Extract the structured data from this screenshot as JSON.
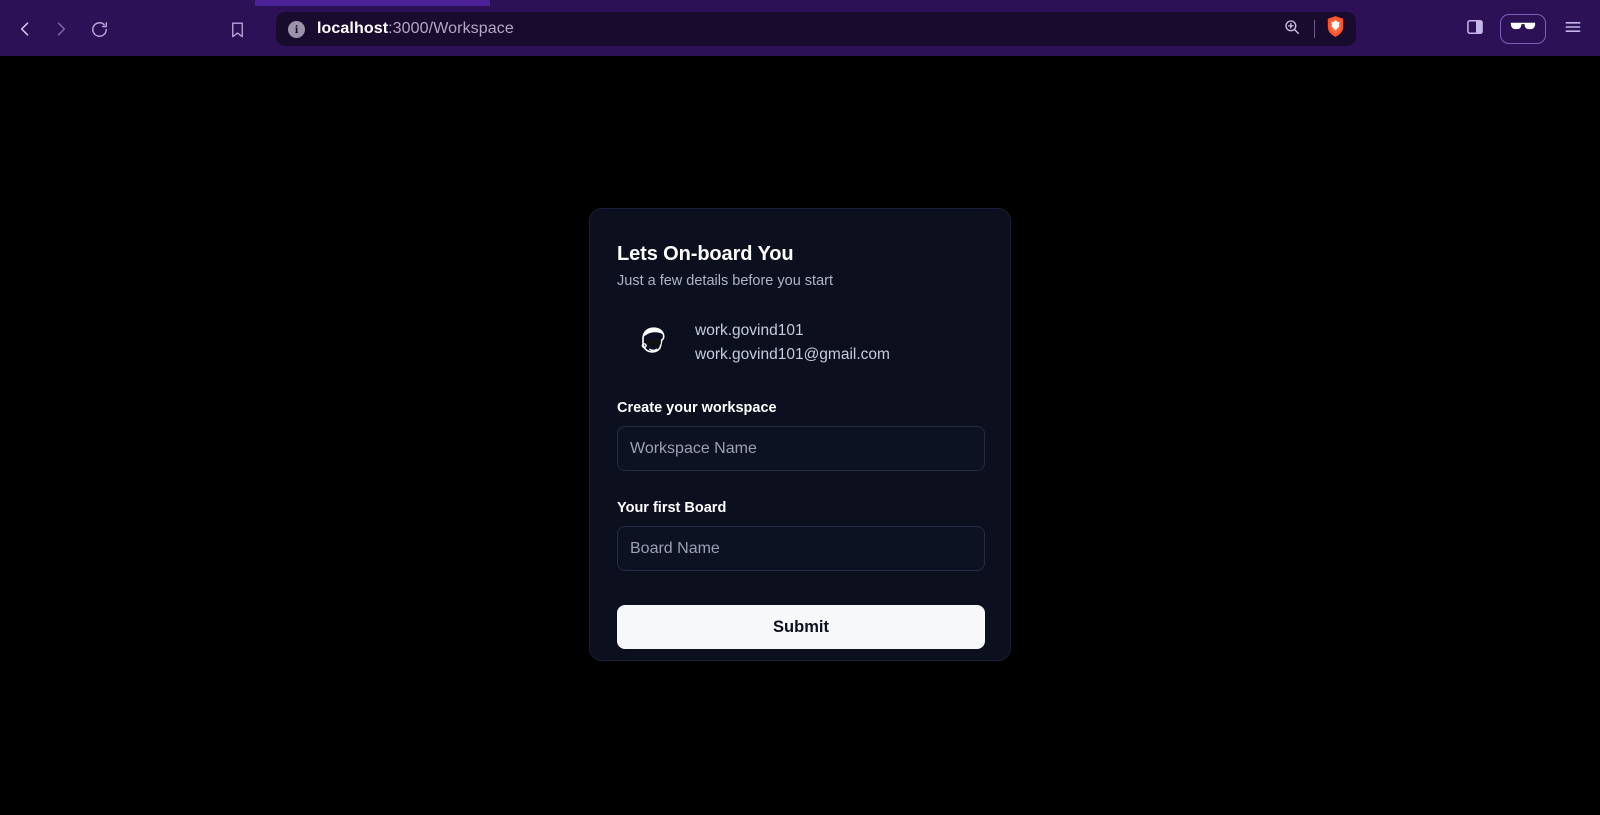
{
  "browser": {
    "name": "Brave",
    "nav": {
      "back_icon": "chevron-left-icon",
      "forward_icon": "chevron-right-icon",
      "reload_icon": "reload-icon",
      "bookmark_icon": "bookmark-icon"
    },
    "omnibox": {
      "info_icon": "site-info-icon",
      "info_glyph": "i",
      "url_host": "localhost",
      "url_rest": ":3000/Workspace",
      "zoom_icon": "zoom-in-icon",
      "shield_icon": "brave-shield-icon"
    },
    "right_actions": {
      "sidebar_icon": "sidebar-panel-icon",
      "glasses_icon": "brave-leo-glasses-icon",
      "menu_icon": "hamburger-menu-icon"
    },
    "colors": {
      "toolbar": "#2d1156",
      "omnibox": "#190b2e",
      "tab_active": "#4b2397",
      "shield_orange": "#fb542b"
    }
  },
  "page": {
    "background": "#000000",
    "card": {
      "title": "Lets On-board You",
      "subtitle": "Just a few details before you start",
      "background": "#0b0f1e",
      "border": "#1a2036",
      "user": {
        "avatar_icon": "user-avatar-icon",
        "name": "work.govind101",
        "email": "work.govind101@gmail.com"
      },
      "fields": [
        {
          "label": "Create your workspace",
          "placeholder": "Workspace Name",
          "value": ""
        },
        {
          "label": "Your first Board",
          "placeholder": "Board Name",
          "value": ""
        }
      ],
      "submit_label": "Submit",
      "submit_color": "#f7f8fa"
    }
  }
}
